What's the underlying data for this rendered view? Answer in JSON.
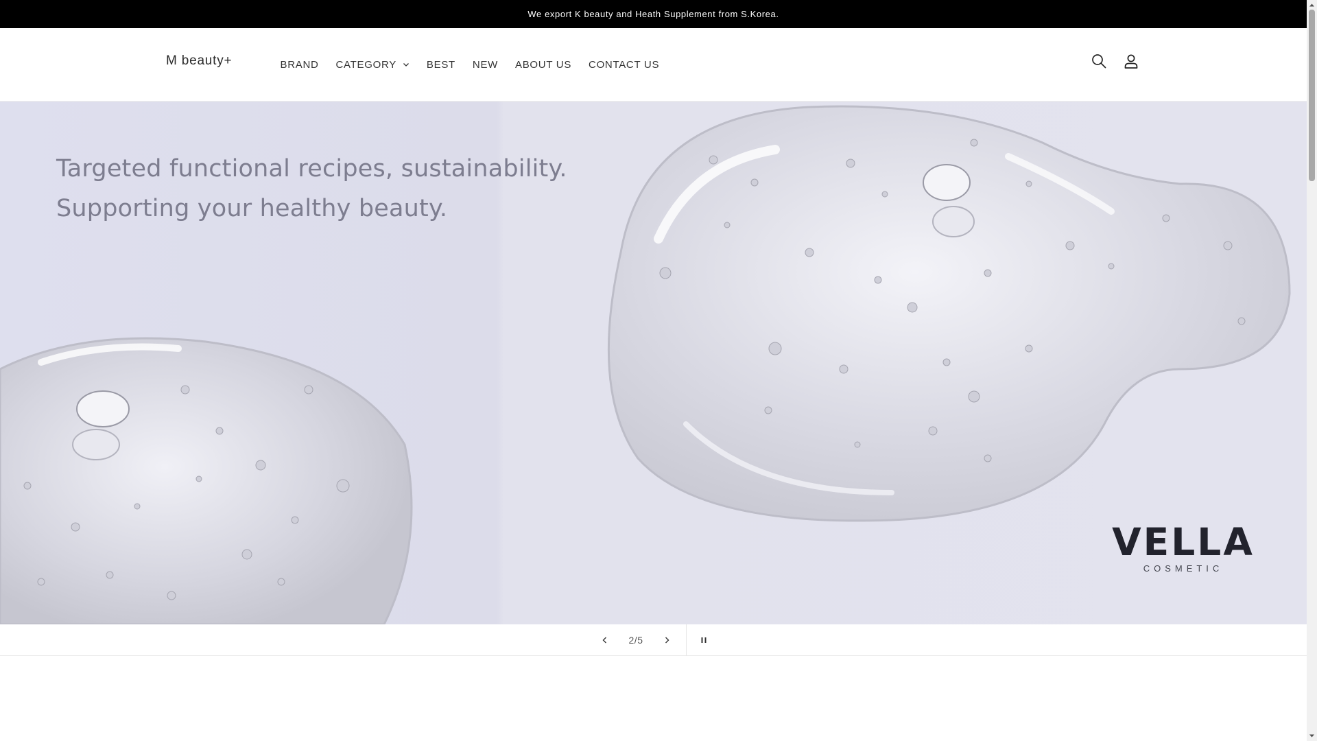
{
  "announcement": {
    "text": "We export K beauty and Heath Supplement from S.Korea."
  },
  "header": {
    "logo": "M beauty+",
    "nav": [
      {
        "label": "BRAND"
      },
      {
        "label": "CATEGORY",
        "has_dropdown": true
      },
      {
        "label": "BEST"
      },
      {
        "label": "NEW"
      },
      {
        "label": "ABOUT US"
      },
      {
        "label": "CONTACT US"
      }
    ],
    "icons": [
      "search-icon",
      "account-icon"
    ]
  },
  "hero": {
    "line1": "Targeted functional recipes, sustainability.",
    "line2": "Supporting your healthy beauty.",
    "brand": "VELLA",
    "brand_sub": "COSMETIC"
  },
  "slider": {
    "counter": "2/5",
    "prev_icon": "chevron-left-icon",
    "next_icon": "chevron-right-icon",
    "pause_icon": "pause-icon"
  },
  "colors": {
    "announcement_bg": "#000000",
    "hero_bg": "#dedfee",
    "hero_text": "#7d7d8f",
    "brand_text": "#22232d"
  }
}
